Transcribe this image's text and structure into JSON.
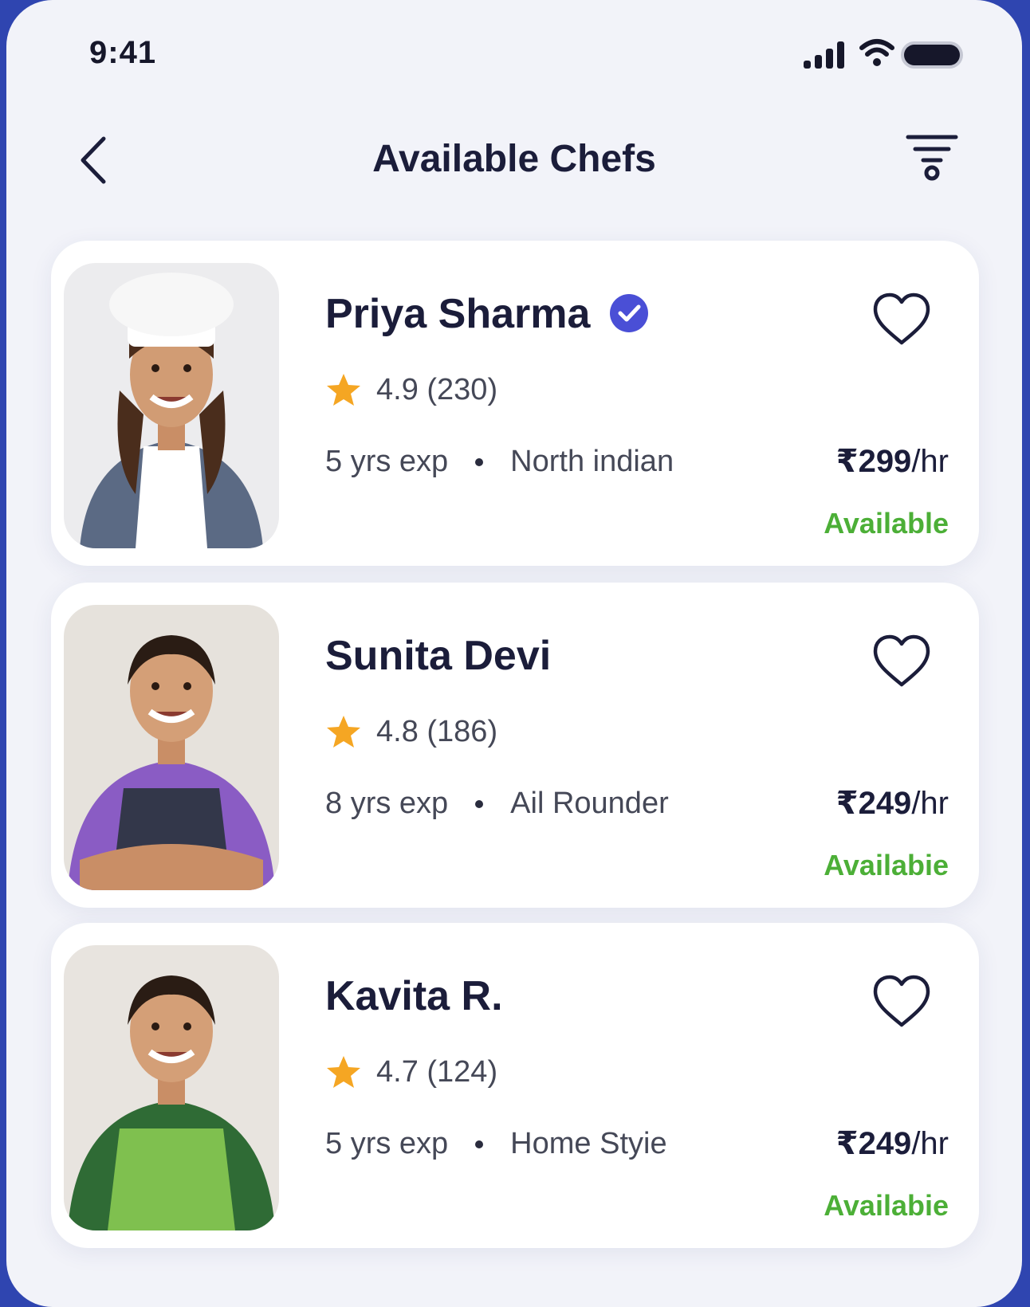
{
  "status_bar": {
    "time": "9:41"
  },
  "header": {
    "title": "Available Chefs"
  },
  "chefs": [
    {
      "name": "Priya Sharma",
      "verified": true,
      "rating": "4.9 (230)",
      "experience": "5 yrs exp",
      "cuisine": "North indian",
      "price": "₹299",
      "price_unit": "/hr",
      "status": "Available"
    },
    {
      "name": "Sunita Devi",
      "verified": false,
      "rating": "4.8 (186)",
      "experience": "8 yrs exp",
      "cuisine": "Ail Rounder",
      "price": "₹249",
      "price_unit": "/hr",
      "status": "Availabie"
    },
    {
      "name": "Kavita R.",
      "verified": false,
      "rating": "4.7 (124)",
      "experience": "5 yrs exp",
      "cuisine": "Home Styie",
      "price": "₹249",
      "price_unit": "/hr",
      "status": "Availabie"
    }
  ],
  "colors": {
    "verified": "#4a4fd6",
    "star": "#f5a623",
    "available": "#4caf37",
    "text_dark": "#1b1d3a"
  }
}
